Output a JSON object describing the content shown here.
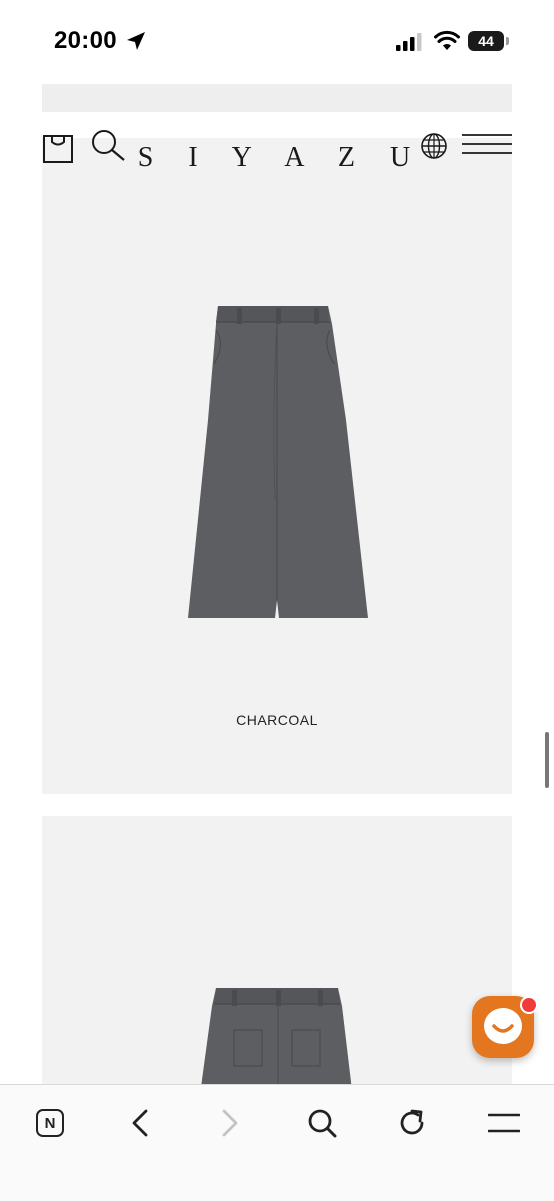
{
  "status_bar": {
    "time": "20:00",
    "battery_level": "44",
    "icons": [
      "location-arrow-icon",
      "cellular-signal-icon",
      "wifi-icon",
      "battery-icon"
    ]
  },
  "header": {
    "logo": "S I Y A Z U",
    "icons": [
      "shopping-bag-icon",
      "search-icon",
      "globe-icon",
      "hamburger-menu-icon"
    ]
  },
  "products": [
    {
      "color_label": "CHARCOAL",
      "color_hex": "#5d5e62",
      "view": "front"
    },
    {
      "color_label": "",
      "color_hex": "#5d5e62",
      "view": "back"
    }
  ],
  "chat": {
    "icon": "chat-face-icon",
    "accent": "#e3761f",
    "notice_color": "#ef3b3b"
  },
  "browser_toolbar": {
    "items": [
      "naver-home-icon",
      "back-arrow-icon",
      "forward-arrow-icon",
      "search-icon",
      "reload-icon",
      "menu-icon"
    ],
    "n_label": "N"
  }
}
